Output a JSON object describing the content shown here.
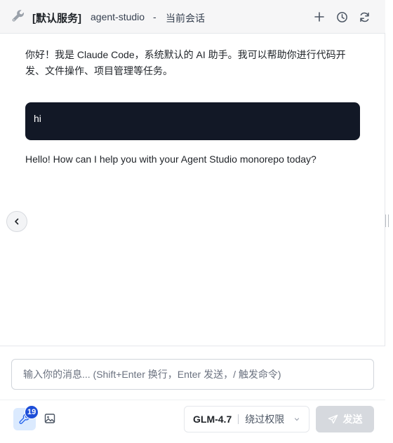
{
  "header": {
    "service_label": "[默认服务]",
    "project_name": "agent-studio",
    "separator": "-",
    "session_label": "当前会话",
    "icons": [
      "wrench-icon",
      "plus-icon",
      "history-icon",
      "refresh-icon"
    ]
  },
  "messages": [
    {
      "role": "assistant",
      "text": "你好！我是 Claude Code，系统默认的 AI 助手。我可以帮助你进行代码开发、文件操作、项目管理等任务。"
    },
    {
      "role": "user",
      "text": "hi"
    },
    {
      "role": "assistant",
      "text": "Hello! How can I help you with your Agent Studio monorepo today?"
    }
  ],
  "composer": {
    "placeholder": "输入你的消息... (Shift+Enter 换行，Enter 发送，/ 触发命令)",
    "value": "",
    "tools_badge_count": "19",
    "model_name": "GLM-4.7",
    "permission_mode": "绕过权限",
    "send_label": "发送"
  },
  "colors": {
    "user_bubble": "#121826",
    "badge": "#1d4ed8",
    "tool_button_bg": "#dbeafe",
    "send_disabled": "#d6d9de"
  }
}
